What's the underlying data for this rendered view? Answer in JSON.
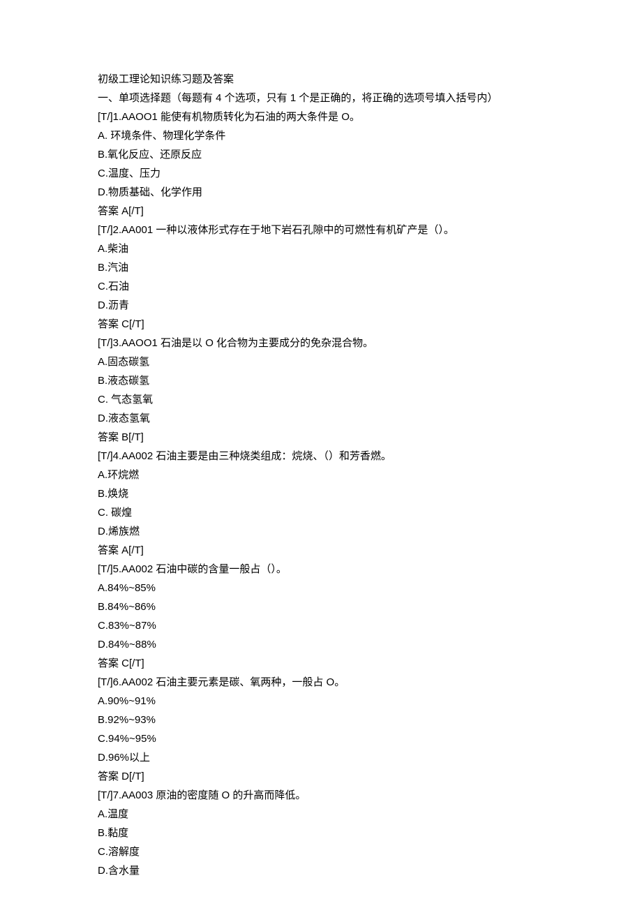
{
  "title": "初级工理论知识练习题及答案",
  "instructions": "一、单项选择题（每题有 4 个选项，只有 1 个是正确的，将正确的选项号填入括号内）",
  "questions": [
    {
      "prompt": "[T/]1.AAOO1 能使有机物质转化为石油的两大条件是 O。",
      "options": [
        "A. 环境条件、物理化学条件",
        "B.氧化反应、还原反应",
        "C.温度、压力",
        "D.物质基础、化学作用"
      ],
      "answer": "答案 A[/T]"
    },
    {
      "prompt": "[T/]2.AA001 一种以液体形式存在于地下岩石孔隙中的可燃性有机矿产是（）。",
      "options": [
        "A.柴油",
        "B.汽油",
        "C.石油",
        "D.沥青"
      ],
      "answer": "答案 C[/T]"
    },
    {
      "prompt": "[T/]3.AAOO1 石油是以 O 化合物为主要成分的免杂混合物。",
      "options": [
        "A.固态碳氢",
        "B.液态碳氢",
        "C. 气态氢氧",
        "D.液态氢氧"
      ],
      "answer": "答案 B[/T]"
    },
    {
      "prompt": "[T/]4.AA002 石油主要是由三种烧类组成：烷烧、（）和芳香燃。",
      "options": [
        "A.环烷燃",
        "B.焕烧",
        "C. 碳煌",
        "D.烯族燃"
      ],
      "answer": "答案 A[/T]"
    },
    {
      "prompt": "[T/]5.AA002 石油中碳的含量一般占（）。",
      "options": [
        "A.84%~85%",
        "B.84%~86%",
        "C.83%~87%",
        "D.84%~88%"
      ],
      "answer": "答案 C[/T]"
    },
    {
      "prompt": "[T/]6.AA002 石油主要元素是碳、氧两种，一般占 O。",
      "options": [
        "A.90%~91%",
        "B.92%~93%",
        "C.94%~95%",
        "D.96%以上"
      ],
      "answer": "答案 D[/T]"
    },
    {
      "prompt": "[T/]7.AA003 原油的密度随 O 的升高而降低。",
      "options": [
        "A.温度",
        "B.黏度",
        "C.溶解度",
        "D.含水量"
      ],
      "answer": ""
    }
  ]
}
